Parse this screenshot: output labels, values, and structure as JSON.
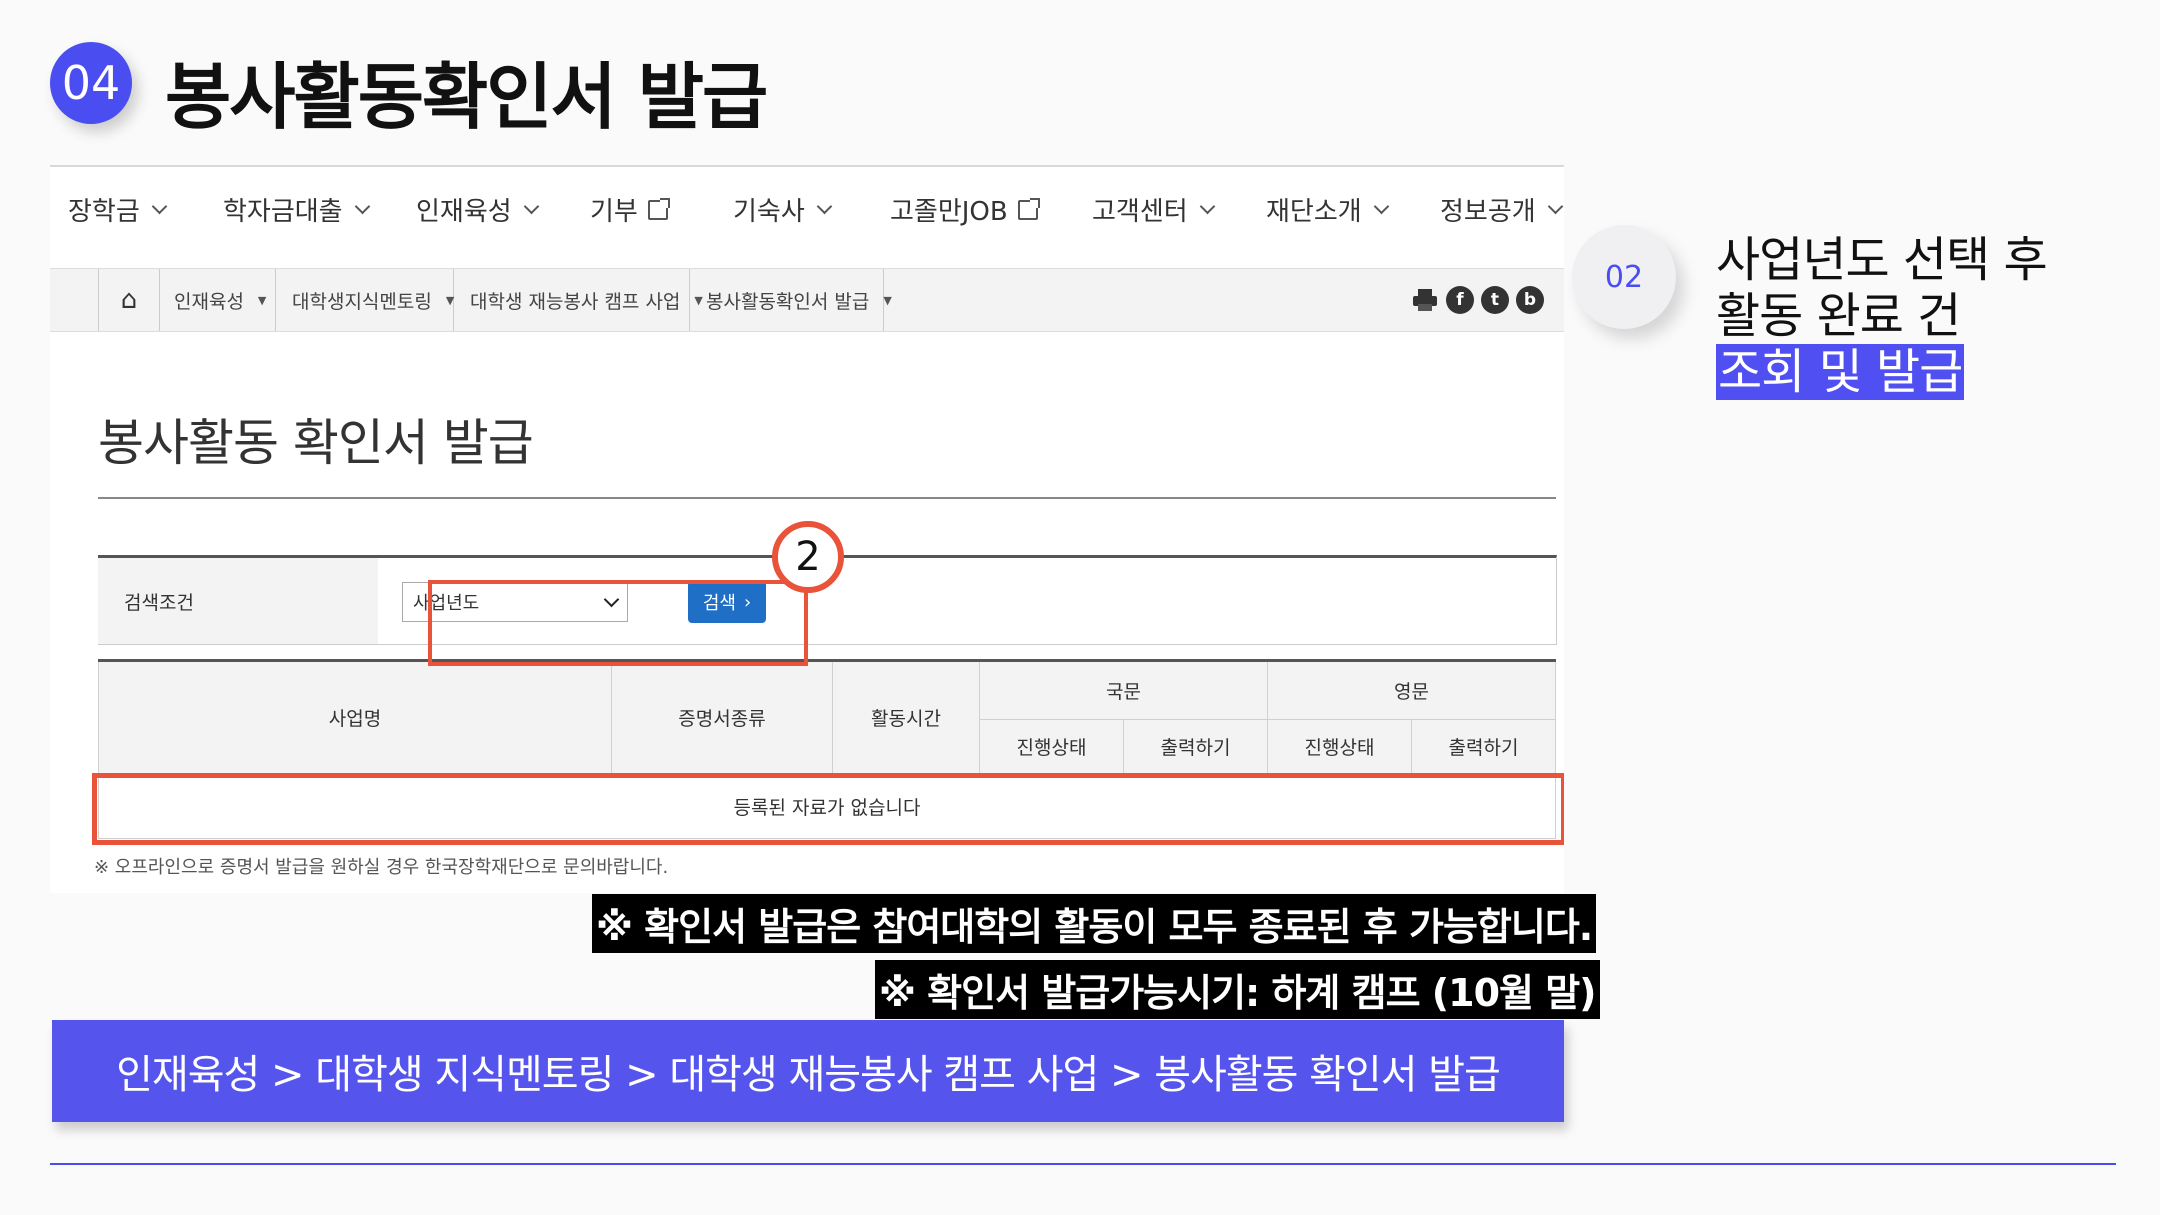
{
  "slide": {
    "step_number": "04",
    "title": "봉사활동확인서 발급"
  },
  "gnb": [
    {
      "label": "장학금",
      "icon": "chevron-down-icon"
    },
    {
      "label": "학자금대출",
      "icon": "chevron-down-icon"
    },
    {
      "label": "인재육성",
      "icon": "chevron-down-icon"
    },
    {
      "label": "기부",
      "icon": "external-link-icon"
    },
    {
      "label": "기숙사",
      "icon": "chevron-down-icon"
    },
    {
      "label": "고졸만JOB",
      "icon": "external-link-icon"
    },
    {
      "label": "고객센터",
      "icon": "chevron-down-icon"
    },
    {
      "label": "재단소개",
      "icon": "chevron-down-icon"
    },
    {
      "label": "정보공개",
      "icon": "chevron-down-icon"
    }
  ],
  "breadcrumb": {
    "home_icon": "⌂",
    "items": [
      "인재육성",
      "대학생지식멘토링",
      "대학생 재능봉사 캠프 사업",
      "봉사활동확인서 발급"
    ],
    "sns": [
      "f",
      "t",
      "b"
    ]
  },
  "page": {
    "heading": "봉사활동 확인서 발급",
    "search": {
      "label": "검색조건",
      "select_value": "사업년도",
      "button_label": "검색",
      "button_arrow": "›",
      "callout_number": "2"
    },
    "table": {
      "col_business": "사업명",
      "col_cert_type": "증명서종류",
      "col_hours": "활동시간",
      "group_korean": "국문",
      "group_english": "영문",
      "sub_status": "진행상태",
      "sub_print": "출력하기",
      "empty_message": "등록된 자료가 없습니다"
    },
    "footnote": "※ 오프라인으로 증명서 발급을 원하실 경우 한국장학재단으로 문의바랍니다."
  },
  "notices": [
    "※ 확인서 발급은 참여대학의 활동이 모두 종료된 후 가능합니다.",
    "※ 확인서  발급가능시기: 하계 캠프 (10월 말)"
  ],
  "path_bar": "인재육성 > 대학생 지식멘토링 > 대학생 재능봉사 캠프 사업 > 봉사활동 확인서 발급",
  "side": {
    "step_number": "02",
    "line1": "사업년도 선택 후",
    "line2": "활동 완료 건",
    "line3_highlight": "조회 및 발급"
  },
  "colors": {
    "accent": "#4a4ef0",
    "highlight_box": "#e8533a",
    "search_button": "#1f6fc6"
  }
}
